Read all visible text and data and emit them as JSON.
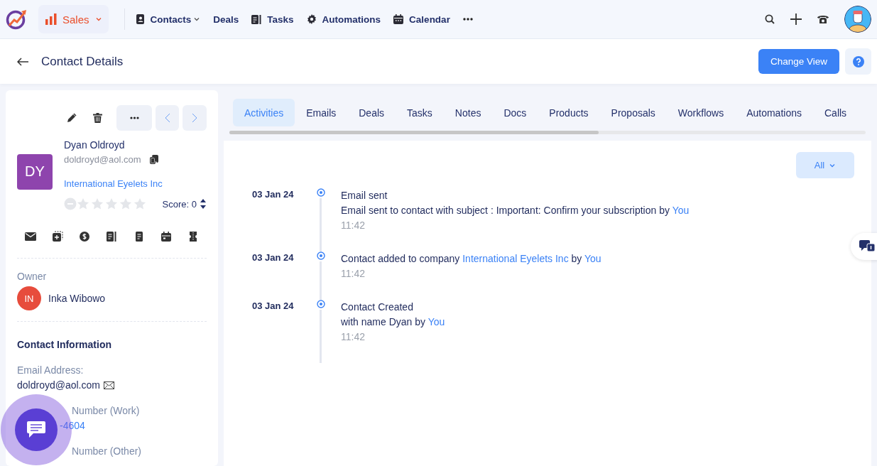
{
  "app": {
    "module": "Sales"
  },
  "nav": [
    {
      "label": "Contacts",
      "kind": "contacts",
      "dropdown": true
    },
    {
      "label": "Deals",
      "kind": "plain",
      "dropdown": false
    },
    {
      "label": "Tasks",
      "kind": "tasks",
      "dropdown": false
    },
    {
      "label": "Automations",
      "kind": "automations",
      "dropdown": false
    },
    {
      "label": "Calendar",
      "kind": "calendar",
      "dropdown": false
    }
  ],
  "page": {
    "title": "Contact Details",
    "primary_button": "Change View"
  },
  "contact": {
    "initials": "DY",
    "name": "Dyan Oldroyd",
    "email": "doldroyd@aol.com",
    "company": "International Eyelets Inc",
    "stars": 0,
    "score": "Score: 0",
    "owner_label": "Owner",
    "owner_initials": "IN",
    "owner_name": "Inka Wibowo",
    "section_title": "Contact Information",
    "fields": [
      {
        "label": "Email Address:",
        "value": "doldroyd@aol.com",
        "kind": "email"
      },
      {
        "label": "Number (Work)",
        "value": "-4604",
        "kind": "phone"
      },
      {
        "label": "Number (Other)",
        "kind": "phone"
      }
    ]
  },
  "tabs": [
    {
      "label": "Activities",
      "selected": true
    },
    {
      "label": "Emails",
      "selected": false
    },
    {
      "label": "Deals",
      "selected": false
    },
    {
      "label": "Tasks",
      "selected": false
    },
    {
      "label": "Notes",
      "selected": false
    },
    {
      "label": "Docs",
      "selected": false
    },
    {
      "label": "Products",
      "selected": false
    },
    {
      "label": "Proposals",
      "selected": false
    },
    {
      "label": "Workflows",
      "selected": false
    },
    {
      "label": "Automations",
      "selected": false
    },
    {
      "label": "Calls",
      "selected": false
    }
  ],
  "filter": {
    "label": "All"
  },
  "activities": [
    {
      "date": "03 Jan 24",
      "lines": [
        [
          {
            "text": "Email sent",
            "link": false
          }
        ],
        [
          {
            "text": "Email sent to contact with subject : Important: Confirm your subscription by",
            "link": false
          },
          {
            "text": "You",
            "link": true
          }
        ]
      ],
      "time": "11:42"
    },
    {
      "date": "03 Jan 24",
      "lines": [
        [
          {
            "text": "Contact added to company",
            "link": false
          },
          {
            "text": "International Eyelets Inc",
            "link": true
          },
          {
            "text": "by",
            "link": false
          },
          {
            "text": "You",
            "link": true
          }
        ]
      ],
      "time": "11:42"
    },
    {
      "date": "03 Jan 24",
      "lines": [
        [
          {
            "text": "Contact Created",
            "link": false
          }
        ],
        [
          {
            "text": "with name Dyan by",
            "link": false
          },
          {
            "text": "You",
            "link": true
          }
        ]
      ],
      "time": "11:42"
    }
  ]
}
